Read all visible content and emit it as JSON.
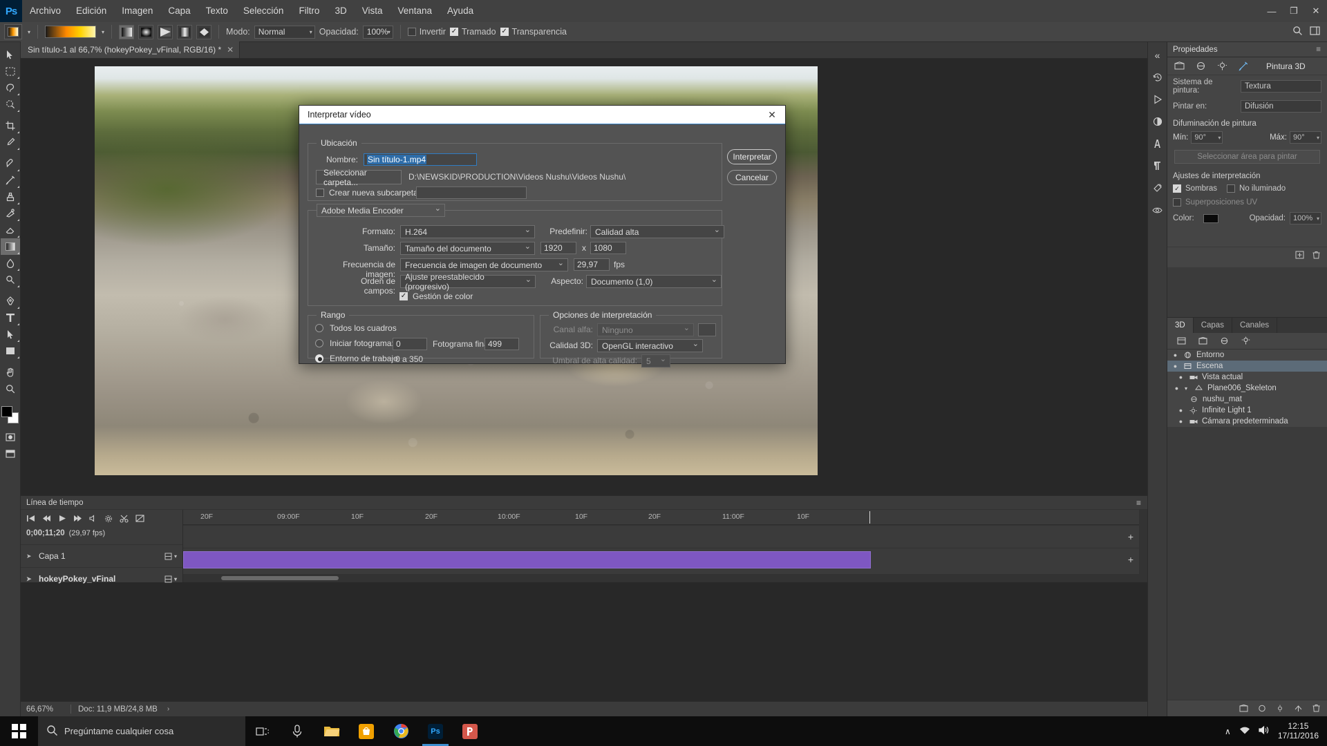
{
  "menubar": {
    "app_badge": "Ps",
    "items": [
      "Archivo",
      "Edición",
      "Imagen",
      "Capa",
      "Texto",
      "Selección",
      "Filtro",
      "3D",
      "Vista",
      "Ventana",
      "Ayuda"
    ],
    "window_buttons": [
      "—",
      "❐",
      "✕"
    ]
  },
  "optionsbar": {
    "mode_label": "Modo:",
    "mode_value": "Normal",
    "opacity_label": "Opacidad:",
    "opacity_value": "100%",
    "invert_label": "Invertir",
    "dither_label": "Tramado",
    "transparency_label": "Transparencia",
    "search_icon": "search-icon",
    "workspace_icon": "workspace-icon"
  },
  "document_tab": {
    "title": "Sin título-1 al 66,7% (hokeyPokey_vFinal, RGB/16) *",
    "close": "✕"
  },
  "statusbar": {
    "zoom": "66,67%",
    "doc_info": "Doc: 11,9 MB/24,8 MB",
    "arrow": "›"
  },
  "timeline": {
    "panel_title": "Línea de tiempo",
    "menu_icon": "panel-menu-icon",
    "current_time": "0;00;11;20",
    "fps_label": "(29,97 fps)",
    "ruler_ticks": [
      "20F",
      "09:00F",
      "10F",
      "20F",
      "10:00F",
      "10F",
      "20F",
      "11:00F",
      "10F"
    ],
    "tracks": [
      {
        "name": "Capa 1",
        "bold": false,
        "has_clip": false
      },
      {
        "name": "hokeyPokey_vFinal",
        "bold": true,
        "has_clip": true,
        "clip_color": "#7e57c2"
      }
    ],
    "add_icon": "+"
  },
  "properties_panel": {
    "tab_label": "Propiedades",
    "menu_icon": "panel-menu-icon",
    "title": "Pintura 3D",
    "paint_system_label": "Sistema de pintura:",
    "paint_system_value": "Textura",
    "paint_on_label": "Pintar en:",
    "paint_on_value": "Difusión",
    "blur_section": "Difuminación de pintura",
    "min_label": "Mín:",
    "min_value": "90°",
    "max_label": "Máx:",
    "max_value": "90°",
    "select_area_button": "Seleccionar área para pintar",
    "render_section": "Ajustes de interpretación",
    "shadows_label": "Sombras",
    "shadows_checked": true,
    "unlit_label": "No iluminado",
    "unlit_checked": false,
    "uv_overlays_label": "Superposiciones UV",
    "uv_checked": false,
    "color_label": "Color:",
    "color_value": "#0a0a0a",
    "opacity_label": "Opacidad:",
    "opacity_value": "100%"
  },
  "layers3d_panel": {
    "tabs": [
      "3D",
      "Capas",
      "Canales"
    ],
    "active_tab": "3D",
    "items": [
      {
        "label": "Entorno",
        "icon": "environment-icon",
        "indent": 0,
        "selected": false,
        "expandable": false
      },
      {
        "label": "Escena",
        "icon": "scene-icon",
        "indent": 0,
        "selected": true,
        "expandable": false
      },
      {
        "label": "Vista actual",
        "icon": "camera-icon",
        "indent": 1,
        "selected": false,
        "expandable": false
      },
      {
        "label": "Plane006_Skeleton",
        "icon": "mesh-icon",
        "indent": 1,
        "selected": false,
        "expandable": true
      },
      {
        "label": "nushu_mat",
        "icon": "material-icon",
        "indent": 2,
        "selected": false,
        "expandable": false
      },
      {
        "label": "Infinite Light 1",
        "icon": "light-icon",
        "indent": 1,
        "selected": false,
        "expandable": false
      },
      {
        "label": "Cámara predeterminada",
        "icon": "camera-icon",
        "indent": 1,
        "selected": false,
        "expandable": false
      }
    ]
  },
  "dialog": {
    "title": "Interpretar vídeo",
    "close_icon": "close-icon",
    "buttons": {
      "primary": "Interpretar",
      "secondary": "Cancelar"
    },
    "location": {
      "legend": "Ubicación",
      "name_label": "Nombre:",
      "name_value": "Sin título-1.mp4",
      "select_folder_button": "Seleccionar carpeta...",
      "path": "D:\\NEWSKID\\PRODUCTION\\Videos Nushu\\Videos Nushu\\",
      "new_subfolder_label": "Crear nueva subcarpeta:",
      "new_subfolder_checked": false,
      "new_subfolder_value": ""
    },
    "encoder": {
      "engine": "Adobe Media Encoder",
      "format_label": "Formato:",
      "format_value": "H.264",
      "preset_label": "Predefinir:",
      "preset_value": "Calidad alta",
      "size_label": "Tamaño:",
      "size_value": "Tamaño del documento",
      "width": "1920",
      "x_label": "x",
      "height": "1080",
      "fps_label": "Frecuencia de imagen:",
      "fps_value": "Frecuencia de imagen de documento",
      "fps_number": "29,97",
      "fps_unit": "fps",
      "field_order_label": "Orden de campos:",
      "field_order_value": "Ajuste preestablecido (progresivo)",
      "aspect_label": "Aspecto:",
      "aspect_value": "Documento (1,0)",
      "color_management_label": "Gestión de color",
      "color_management_checked": true
    },
    "range": {
      "legend": "Rango",
      "all_frames_label": "Todos los cuadros",
      "start_frame_label": "Iniciar fotograma:",
      "start_frame_value": "0",
      "end_frame_label": "Fotograma final:",
      "end_frame_value": "499",
      "work_area_label": "Entorno de trabajo:",
      "work_area_value": "0 a 350",
      "selected": "work_area"
    },
    "render_options": {
      "legend": "Opciones de interpretación",
      "alpha_label": "Canal alfa:",
      "alpha_value": "Ninguno",
      "quality3d_label": "Calidad 3D:",
      "quality3d_value": "OpenGL interactivo",
      "threshold_label": "Umbral de alta calidad:",
      "threshold_value": "5"
    }
  },
  "taskbar": {
    "search_placeholder": "Pregúntame cualquier cosa",
    "search_icon": "search-circle-icon",
    "apps": [
      {
        "name": "task-view",
        "label": ""
      },
      {
        "name": "cortana-mic",
        "label": ""
      },
      {
        "name": "file-explorer",
        "label": ""
      },
      {
        "name": "store",
        "label": ""
      },
      {
        "name": "chrome",
        "label": ""
      },
      {
        "name": "photoshop",
        "label": "Ps",
        "active": true
      },
      {
        "name": "premiere",
        "label": ""
      }
    ],
    "tray": {
      "chevron": "∧",
      "network": "network-icon",
      "volume": "volume-icon"
    },
    "time": "12:15",
    "date": "17/11/2016"
  },
  "colors": {
    "accent_blue": "#2f7dc4",
    "clip_purple": "#7e57c2",
    "selection_blue": "#2d6ca8",
    "panel_bg": "#3b3b3b"
  }
}
